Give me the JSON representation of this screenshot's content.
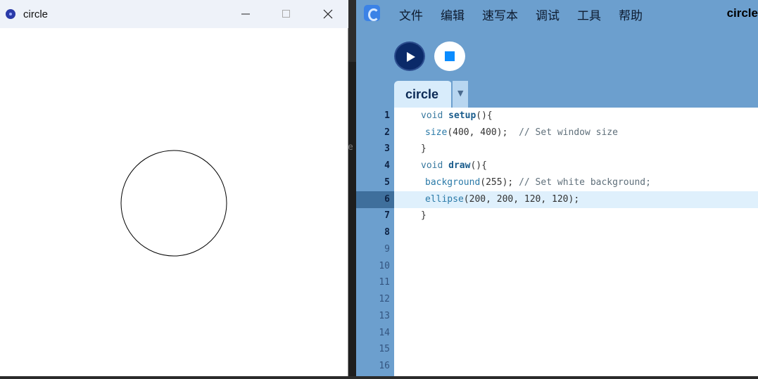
{
  "sketch_window": {
    "title": "circle",
    "circle": {
      "fill": "#ffffff",
      "stroke": "#000000"
    }
  },
  "ide": {
    "title": "circle",
    "menu": [
      "文件",
      "编辑",
      "速写本",
      "调试",
      "工具",
      "帮助"
    ],
    "tab_label": "circle",
    "line_numbers": [
      "1",
      "2",
      "3",
      "4",
      "5",
      "6",
      "7",
      "8",
      "9",
      "10",
      "11",
      "12",
      "13",
      "14",
      "15",
      "16"
    ],
    "current_line": "6",
    "code": {
      "l1_kw": "void",
      "l1_fn": "setup",
      "l1_rest": "(){",
      "l2_call": "size",
      "l2_args": "(400, 400);",
      "l2_comment": "// Set window size",
      "l3": "}",
      "l4_kw": "void",
      "l4_fn": "draw",
      "l4_rest": "(){",
      "l5_call": "background",
      "l5_args": "(255);",
      "l5_comment": "// Set white background;",
      "l6_call": "ellipse",
      "l6_args": "(200, 200, 120, 120);",
      "l7": "}"
    }
  },
  "background_text": "e"
}
